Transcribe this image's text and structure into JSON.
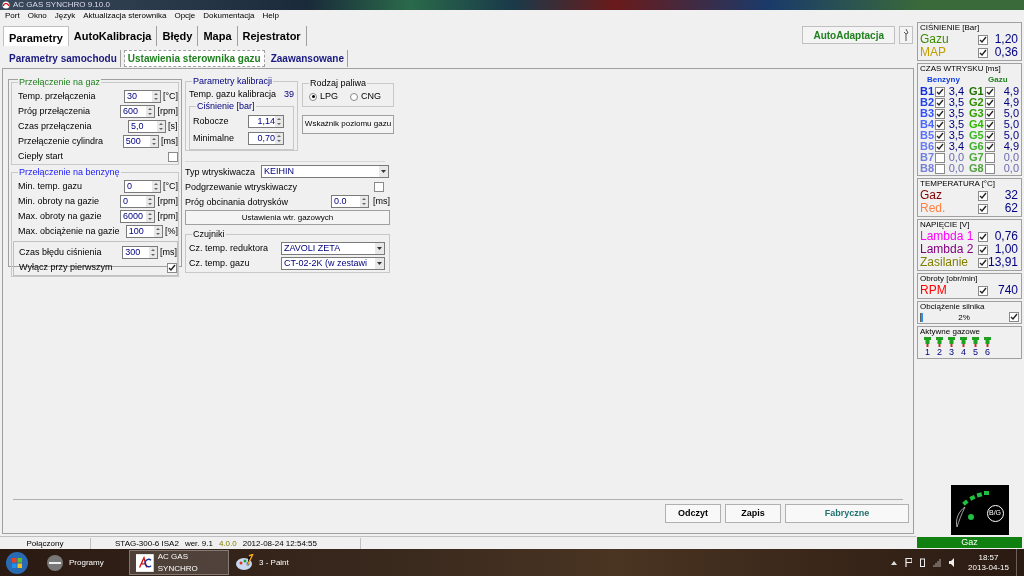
{
  "window": {
    "title": "AC GAS SYNCHRO  9.10.0"
  },
  "menu": [
    "Port",
    "Okno",
    "Język",
    "Aktualizacja sterownika",
    "Opcje",
    "Dokumentacja",
    "Help"
  ],
  "tabs": [
    {
      "label": "Parametry",
      "selected": true
    },
    {
      "label": "AutoKalibracja",
      "selected": false
    },
    {
      "label": "Błędy",
      "selected": false
    },
    {
      "label": "Mapa",
      "selected": false
    },
    {
      "label": "Rejestrator",
      "selected": false
    }
  ],
  "auto_adaptation_button": "AutoAdaptacja",
  "subtabs": [
    {
      "label": "Parametry samochodu",
      "selected": false
    },
    {
      "label": "Ustawienia sterownika gazu",
      "selected": true
    },
    {
      "label": "Zaawansowane",
      "selected": false
    }
  ],
  "switch_to_gas": {
    "title": "Przełączenie na gaz",
    "rows": [
      {
        "kind": "spin",
        "label": "Temp. przełączenia",
        "value": "30",
        "unit": "[°C]"
      },
      {
        "kind": "spin",
        "label": "Próg przełączenia",
        "value": "600",
        "unit": "[rpm]"
      },
      {
        "kind": "spin",
        "label": "Czas przełączenia",
        "value": "5,0",
        "unit": "[s]"
      },
      {
        "kind": "spin",
        "label": "Przełączenie cylindra",
        "value": "500",
        "unit": "[ms]"
      },
      {
        "kind": "check",
        "label": "Ciepły start",
        "checked": false
      }
    ]
  },
  "switch_to_petrol": {
    "title": "Przełączenie na benzynę",
    "rows": [
      {
        "kind": "spin",
        "label": "Min. temp. gazu",
        "value": "0",
        "unit": "[°C]"
      },
      {
        "kind": "spin",
        "label": "Min. obroty na gazie",
        "value": "0",
        "unit": "[rpm]"
      },
      {
        "kind": "spin",
        "label": "Max. obroty na gazie",
        "value": "6000",
        "unit": "[rpm]"
      },
      {
        "kind": "spin",
        "label": "Max. obciążenie na gazie",
        "value": "100",
        "unit": "[%]"
      }
    ],
    "pressure_error_rows": [
      {
        "kind": "spin",
        "label": "Czas błędu ciśnienia",
        "value": "300",
        "unit": "[ms]"
      },
      {
        "kind": "check",
        "label": "Wyłącz przy pierwszym",
        "checked": true
      }
    ]
  },
  "calibration": {
    "title": "Parametry kalibracji",
    "temp_label": "Temp. gazu kalibracja",
    "temp_value": "39",
    "pressure_title": "Ciśnienie [bar]",
    "rows": [
      {
        "label": "Robocze",
        "value": "1,14"
      },
      {
        "label": "Minimalne",
        "value": "0,70"
      }
    ]
  },
  "fuel_type": {
    "title": "Rodzaj paliwa",
    "options": [
      {
        "label": "LPG",
        "selected": true
      },
      {
        "label": "CNG",
        "selected": false
      }
    ]
  },
  "gas_level_button": "Wskaźnik poziomu gazu",
  "injectors": {
    "rows": [
      {
        "kind": "select",
        "label": "Typ wtryskiwacza",
        "value": "KEIHIN"
      },
      {
        "kind": "check",
        "label": "Podgrzewanie wtryskiwaczy",
        "checked": false
      },
      {
        "kind": "spin",
        "label": "Próg obcinania dotrysków",
        "value": "0.0",
        "unit": "[ms]"
      }
    ],
    "button": "Ustawienia wtr. gazowych"
  },
  "sensors": {
    "title": "Czujniki",
    "rows": [
      {
        "label": "Cz. temp. reduktora",
        "value": "ZAVOLI ZETA"
      },
      {
        "label": "Cz. temp. gazu",
        "value": "CT-02-2K (w zestawi"
      }
    ]
  },
  "action_buttons": [
    {
      "label": "Odczyt",
      "accent": false
    },
    {
      "label": "Zapis",
      "accent": false
    },
    {
      "label": "Fabryczne",
      "accent": true
    }
  ],
  "status_bar": {
    "connection": "Połączony",
    "device": "STAG-300-6 ISA2",
    "version": "wer. 9.1",
    "firmware": "4.0.0",
    "date": "2012-08-24 12:54:55"
  },
  "pressure": {
    "title": "CIŚNIENIE [Bar]",
    "rows": [
      {
        "label": "Gazu",
        "color": "#3a8a00",
        "checked": true,
        "value": "1,20"
      },
      {
        "label": "MAP",
        "color": "#c0a000",
        "checked": true,
        "value": "0,36"
      }
    ]
  },
  "injection_time": {
    "title": "CZAS WTRYSKU",
    "unit": "[ms]",
    "petrol_heading": "Benzyny",
    "gas_heading": "Gazu",
    "rows": [
      {
        "petrol": {
          "label": "B1",
          "color": "#1030e0",
          "checked": true,
          "value": "3,4"
        },
        "gas": {
          "label": "G1",
          "color": "#207000",
          "checked": true,
          "value": "4,9"
        }
      },
      {
        "petrol": {
          "label": "B2",
          "color": "#2040f0",
          "checked": true,
          "value": "3,5"
        },
        "gas": {
          "label": "G2",
          "color": "#309000",
          "checked": true,
          "value": "4,9"
        }
      },
      {
        "petrol": {
          "label": "B3",
          "color": "#3050ff",
          "checked": true,
          "value": "3,5"
        },
        "gas": {
          "label": "G3",
          "color": "#30a000",
          "checked": true,
          "value": "5,0"
        }
      },
      {
        "petrol": {
          "label": "B4",
          "color": "#4a68ff",
          "checked": true,
          "value": "3,5"
        },
        "gas": {
          "label": "G4",
          "color": "#30b800",
          "checked": true,
          "value": "5,0"
        }
      },
      {
        "petrol": {
          "label": "B5",
          "color": "#5a70ff",
          "checked": true,
          "value": "3,5"
        },
        "gas": {
          "label": "G5",
          "color": "#38b820",
          "checked": true,
          "value": "5,0"
        }
      },
      {
        "petrol": {
          "label": "B6",
          "color": "#6a7cf0",
          "checked": true,
          "value": "3,4"
        },
        "gas": {
          "label": "G6",
          "color": "#40b030",
          "checked": true,
          "value": "4,9"
        }
      },
      {
        "petrol": {
          "label": "B7",
          "color": "#7080e0",
          "checked": false,
          "value": "0,0"
        },
        "gas": {
          "label": "G7",
          "color": "#48a838",
          "checked": false,
          "value": "0,0"
        }
      },
      {
        "petrol": {
          "label": "B8",
          "color": "#7480d8",
          "checked": false,
          "value": "0,0"
        },
        "gas": {
          "label": "G8",
          "color": "#50a040",
          "checked": false,
          "value": "0,0"
        }
      }
    ]
  },
  "temperature": {
    "title": "TEMPERATURA  [°C]",
    "rows": [
      {
        "label": "Gaz",
        "color": "#800000",
        "checked": true,
        "value": "32"
      },
      {
        "label": "Red.",
        "color": "#ff8040",
        "checked": true,
        "value": "62"
      }
    ]
  },
  "voltage": {
    "title": "NAPIĘCIE [V]",
    "rows": [
      {
        "label": "Lambda 1",
        "color": "#ff00ff",
        "checked": true,
        "value": "0,76"
      },
      {
        "label": "Lambda 2",
        "color": "#800080",
        "checked": true,
        "value": "1,00"
      },
      {
        "label": "Zasilanie",
        "color": "#808000",
        "checked": true,
        "value": "13,91"
      }
    ]
  },
  "rpm": {
    "title": "Obroty [obr/min]",
    "rows": [
      {
        "label": "RPM",
        "color": "#ff0000",
        "checked": true,
        "value": "740"
      }
    ]
  },
  "engine_load": {
    "title": "Obciążenie silnika",
    "level": 0.02,
    "reading": "2%",
    "checked": true
  },
  "active_injectors": {
    "title": "Aktywne gazowe",
    "items": [
      {
        "label": "1",
        "active": true
      },
      {
        "label": "2",
        "active": true
      },
      {
        "label": "3",
        "active": true
      },
      {
        "label": "4",
        "active": true
      },
      {
        "label": "5",
        "active": true
      },
      {
        "label": "6",
        "active": true
      }
    ]
  },
  "gauge": {
    "mode": "B/G",
    "fuel_state": "Gaz"
  },
  "taskbar": {
    "items": [
      {
        "label": "Programy",
        "selected": false
      },
      {
        "label": "AC GAS SYNCHRO",
        "selected": true
      },
      {
        "label": "3 - Paint",
        "selected": false
      }
    ],
    "time": "18:57",
    "date": "2013-04-15"
  }
}
